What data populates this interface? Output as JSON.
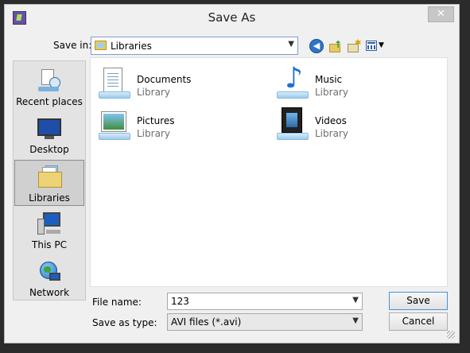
{
  "window": {
    "title": "Save As",
    "close_glyph": "✕"
  },
  "toolbar": {
    "save_in_label": "Save in:",
    "save_in_value": "Libraries",
    "icons": [
      "back-arrow-icon",
      "up-one-level-icon",
      "new-folder-icon",
      "view-menu-icon"
    ]
  },
  "places": [
    {
      "label": "Recent places",
      "icon": "recent-places-icon",
      "selected": false
    },
    {
      "label": "Desktop",
      "icon": "desktop-icon",
      "selected": false
    },
    {
      "label": "Libraries",
      "icon": "libraries-icon",
      "selected": true
    },
    {
      "label": "This PC",
      "icon": "this-pc-icon",
      "selected": false
    },
    {
      "label": "Network",
      "icon": "network-icon",
      "selected": false
    }
  ],
  "libraries": [
    {
      "name": "Documents",
      "type": "Library",
      "icon": "documents-library-icon"
    },
    {
      "name": "Music",
      "type": "Library",
      "icon": "music-library-icon"
    },
    {
      "name": "Pictures",
      "type": "Library",
      "icon": "pictures-library-icon"
    },
    {
      "name": "Videos",
      "type": "Library",
      "icon": "videos-library-icon"
    }
  ],
  "form": {
    "file_name_label": "File name:",
    "file_name_value": "123",
    "save_as_type_label": "Save as type:",
    "save_as_type_value": "AVI files (*.avi)"
  },
  "buttons": {
    "save": "Save",
    "cancel": "Cancel"
  },
  "colors": {
    "selected_place_bg": "#d0d0d0",
    "content_bg": "#ffffff",
    "secondary_text": "#6d6d6d"
  }
}
